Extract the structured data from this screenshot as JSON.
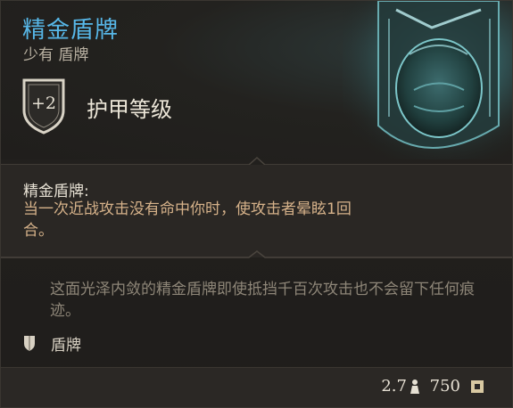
{
  "item": {
    "name": "精金盾牌",
    "subtitle": "少有 盾牌",
    "armor_class": {
      "value": "+2",
      "label": "护甲等级"
    },
    "effect": {
      "title": "精金盾牌:",
      "description": "当一次近战攻击没有命中你时，使攻击者晕眩1回合。"
    },
    "flavor_text": "这面光泽内敛的精金盾牌即使抵挡千百次攻击也不会留下任何痕迹。",
    "type": {
      "icon": "shield-icon",
      "label": "盾牌"
    },
    "weight": "2.7",
    "value": "750"
  },
  "colors": {
    "title": "#57b7e8",
    "effect_text": "#d6b28a",
    "flavor_text": "#8e8678"
  }
}
